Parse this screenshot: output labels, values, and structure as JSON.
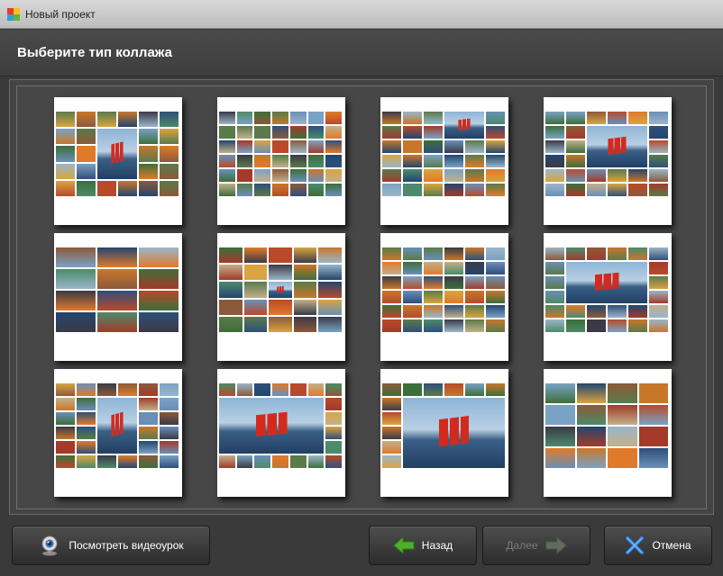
{
  "window": {
    "title": "Новый проект"
  },
  "header": {
    "title": "Выберите тип коллажа"
  },
  "collage_types": [
    {
      "style": "a"
    },
    {
      "style": "b"
    },
    {
      "style": "c"
    },
    {
      "style": "d"
    },
    {
      "style": "e"
    },
    {
      "style": "f"
    },
    {
      "style": "g"
    },
    {
      "style": "h"
    },
    {
      "style": "i"
    },
    {
      "style": "j"
    },
    {
      "style": "k"
    },
    {
      "style": "l"
    }
  ],
  "footer": {
    "video_button": {
      "label": "Посмотреть видеоурок",
      "icon": "webcam-icon"
    },
    "back_button": {
      "label": "Назад",
      "icon": "arrow-left-icon",
      "icon_color": "#4caf2a"
    },
    "next_button": {
      "label": "Далее",
      "icon": "arrow-right-icon",
      "disabled": true
    },
    "cancel_button": {
      "label": "Отмена",
      "icon": "close-x-icon",
      "icon_color": "#2f7fe0"
    }
  },
  "colors": {
    "background": "#3a3a3a",
    "panel": "#474747",
    "text": "#ffffff",
    "disabled_text": "#7c7c7c"
  }
}
